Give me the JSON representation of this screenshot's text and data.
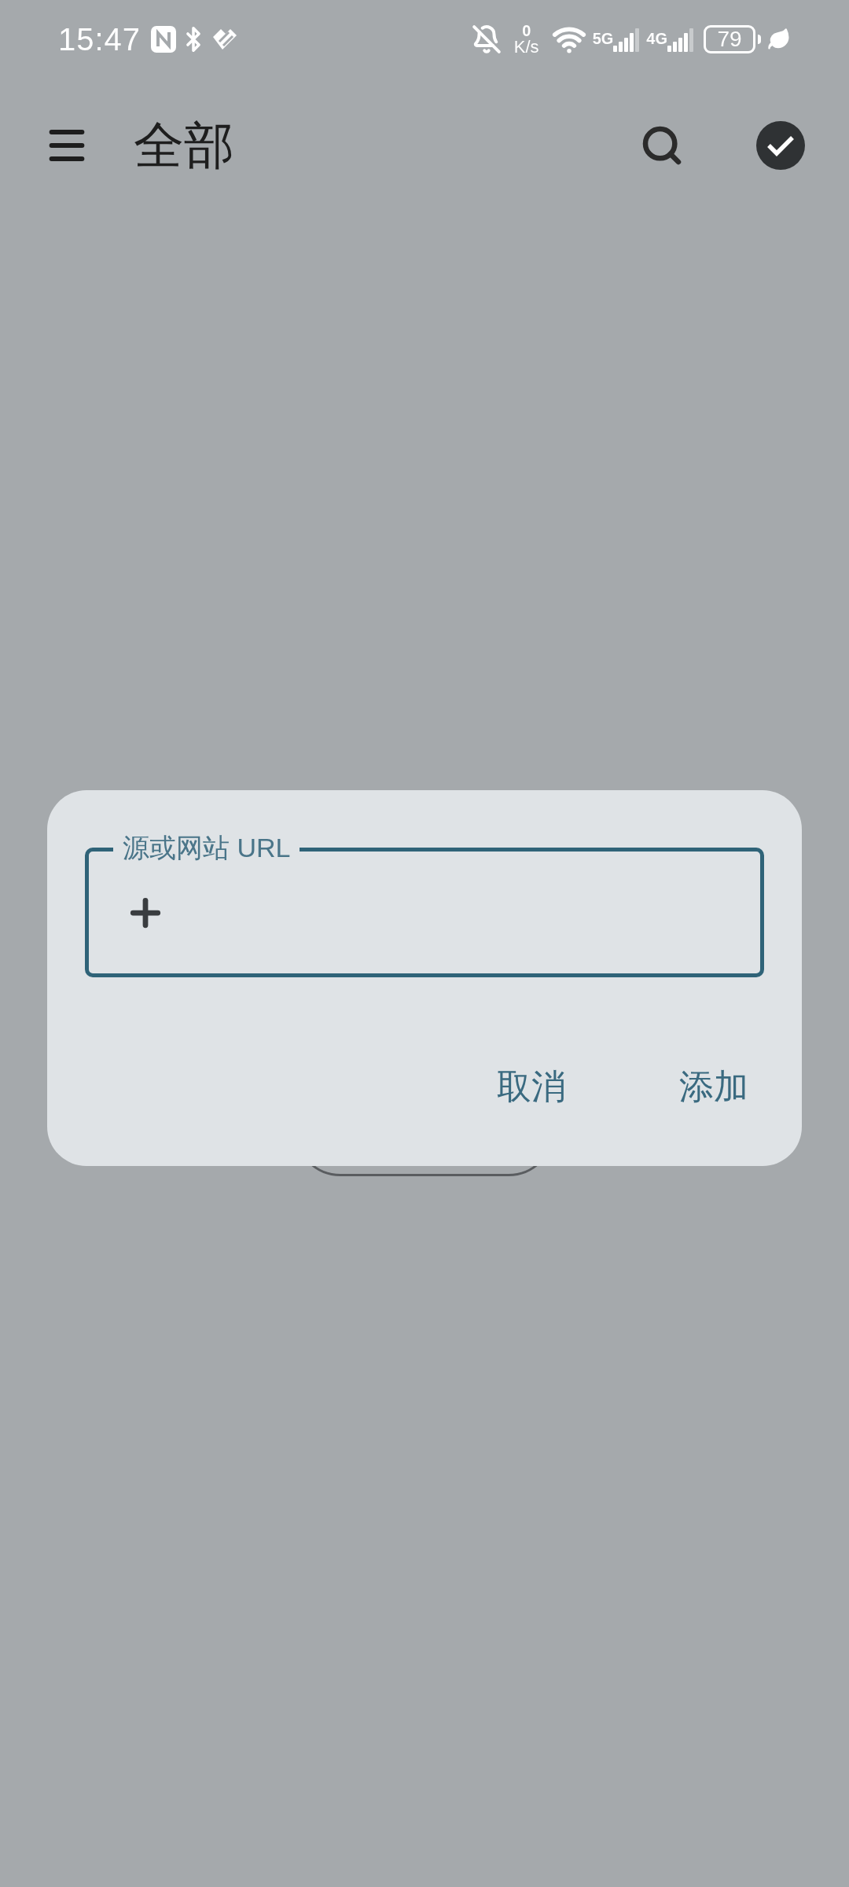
{
  "status_bar": {
    "time": "15:47",
    "net_speed_value": "0",
    "net_speed_unit": "K/s",
    "network_1": "5G",
    "network_2": "4G",
    "battery": "79"
  },
  "app_bar": {
    "title": "全部"
  },
  "dialog": {
    "field": {
      "label": "源或网站 URL"
    },
    "buttons": [
      "取消",
      "添加"
    ]
  }
}
